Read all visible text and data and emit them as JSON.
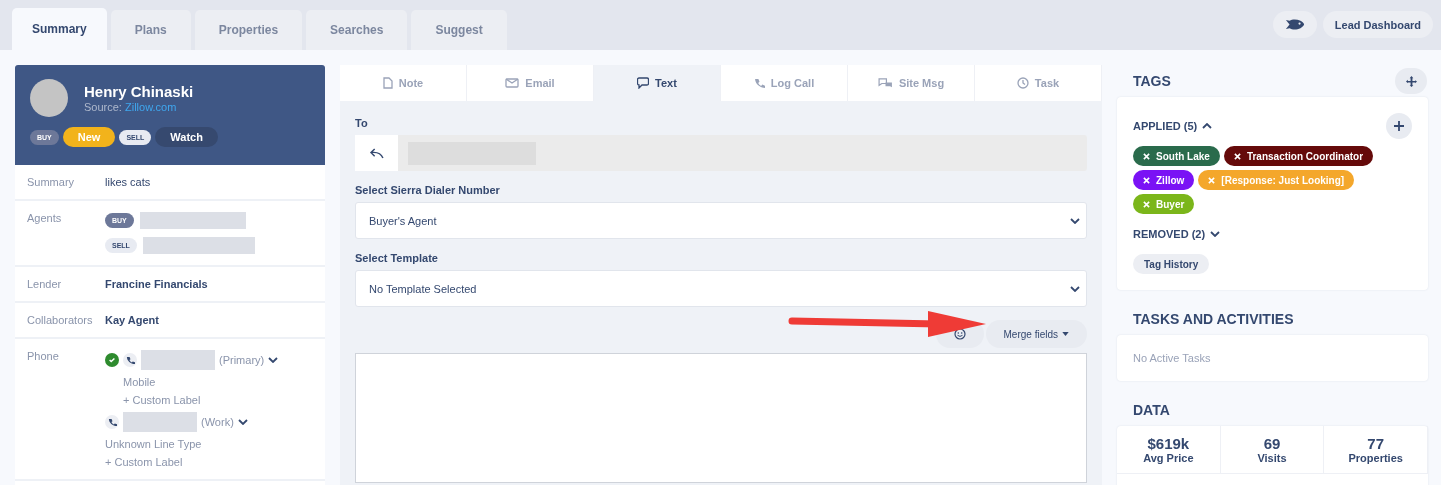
{
  "top_tabs": [
    {
      "label": "Summary",
      "selected": true
    },
    {
      "label": "Plans",
      "selected": false
    },
    {
      "label": "Properties",
      "selected": false
    },
    {
      "label": "Searches",
      "selected": false
    },
    {
      "label": "Suggest",
      "selected": false
    }
  ],
  "top_buttons": {
    "dashboard": "Lead Dashboard"
  },
  "contact": {
    "name": "Henry Chinaski",
    "source_label": "Source:",
    "source": "Zillow.com",
    "badges": [
      {
        "label": "BUY",
        "kind": "small",
        "color": "#6d7899"
      },
      {
        "label": "New",
        "kind": "large",
        "color": "#f2b31b"
      },
      {
        "label": "SELL",
        "kind": "small",
        "color": "#e8ebf2"
      },
      {
        "label": "Watch",
        "kind": "large",
        "color": "#36496f"
      }
    ]
  },
  "details": [
    {
      "kind": "text",
      "label": "Summary",
      "value": "likes cats",
      "bold": false
    },
    {
      "kind": "agents",
      "label": "Agents",
      "agents": [
        {
          "role": "BUY",
          "selected": true
        },
        {
          "role": "SELL",
          "selected": false
        }
      ]
    },
    {
      "kind": "text",
      "label": "Lender",
      "value": "Francine Financials",
      "bold": true
    },
    {
      "kind": "text",
      "label": "Collaborators",
      "value": "Kay Agent",
      "bold": true
    },
    {
      "kind": "phones",
      "label": "Phone",
      "phones": [
        {
          "verified": true,
          "type": "(Primary)",
          "line_type": "Mobile",
          "custom_label": "+ Custom Label"
        },
        {
          "verified": false,
          "type": "(Work)",
          "line_type": "Unknown Line Type",
          "custom_label": "+ Custom Label"
        }
      ]
    }
  ],
  "compose_tabs": [
    {
      "label": "Note",
      "kind": "note",
      "selected": false
    },
    {
      "label": "Email",
      "kind": "email",
      "selected": false
    },
    {
      "label": "Text",
      "kind": "text",
      "selected": true
    },
    {
      "label": "Log Call",
      "kind": "call",
      "selected": false
    },
    {
      "label": "Site Msg",
      "kind": "site",
      "selected": false
    },
    {
      "label": "Task",
      "kind": "task",
      "selected": false
    }
  ],
  "compose": {
    "to_label": "To",
    "dialer_label": "Select Sierra Dialer Number",
    "dialer_value": "Buyer's Agent",
    "template_label": "Select Template",
    "template_value": "No Template Selected",
    "merge_fields": "Merge fields"
  },
  "tags": {
    "title": "TAGS",
    "applied": {
      "label": "APPLIED (5)",
      "expanded": true
    },
    "items": [
      {
        "label": "South Lake",
        "color": "#2a6b4c"
      },
      {
        "label": "Transaction Coordinator",
        "color": "#650a0a"
      },
      {
        "label": "Zillow",
        "color": "#7a12f5"
      },
      {
        "label": "[Response: Just Looking]",
        "color": "#f4a72b"
      },
      {
        "label": "Buyer",
        "color": "#7bb61a"
      }
    ],
    "removed": {
      "label": "REMOVED (2)",
      "expanded": false
    },
    "history": "Tag History"
  },
  "tasks": {
    "title": "TASKS AND ACTIVITIES",
    "empty": "No Active Tasks"
  },
  "data": {
    "title": "DATA",
    "stats": [
      {
        "value": "$619k",
        "label": "Avg Price"
      },
      {
        "value": "69",
        "label": "Visits"
      },
      {
        "value": "77",
        "label": "Properties"
      }
    ]
  }
}
